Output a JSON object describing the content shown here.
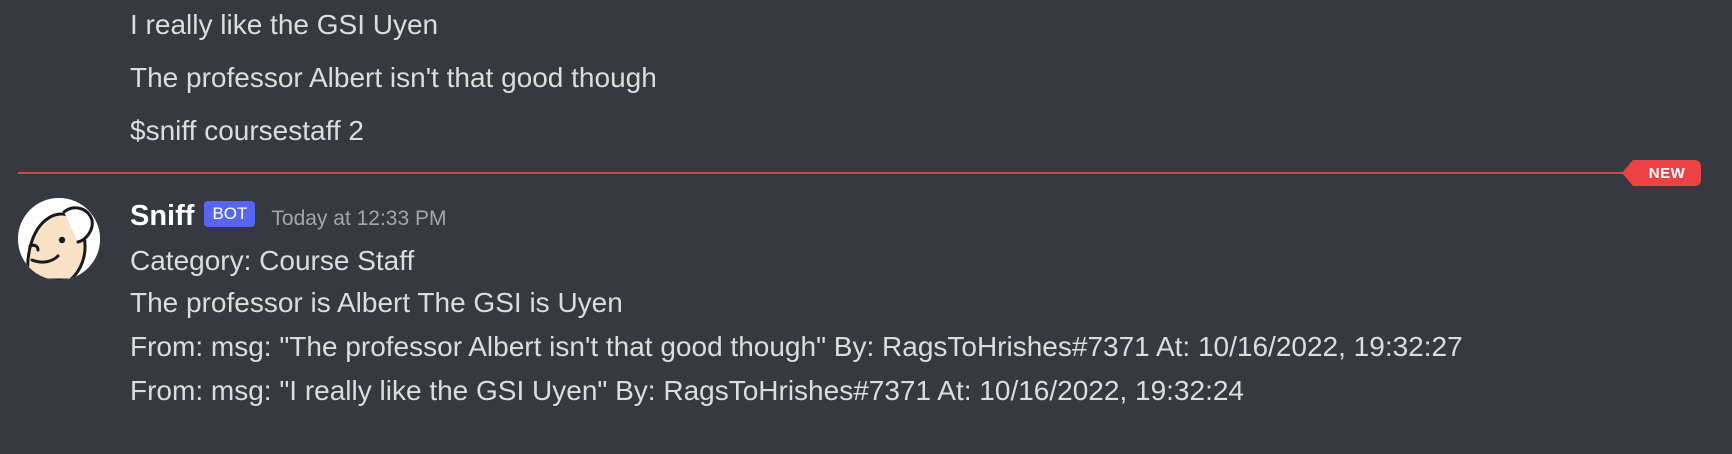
{
  "previous_messages": [
    "I really like the GSI Uyen",
    "The professor Albert isn't that good though",
    "$sniff coursestaff 2"
  ],
  "divider": {
    "badge": "NEW",
    "color": "#ed4245"
  },
  "bot_message": {
    "username": "Sniff",
    "tag": "BOT",
    "timestamp": "Today at 12:33 PM",
    "lines": [
      "Category: Course Staff",
      "The professor is Albert  The GSI is Uyen",
      "From: msg: \"The professor Albert isn't that good though\" By: RagsToHrishes#7371 At: 10/16/2022, 19:32:27",
      "From: msg: \"I really like the GSI Uyen\" By: RagsToHrishes#7371 At: 10/16/2022, 19:32:24"
    ]
  },
  "colors": {
    "background": "#36393f",
    "text": "#dcddde",
    "bot_tag": "#5865f2",
    "timestamp": "#a3a6aa"
  }
}
